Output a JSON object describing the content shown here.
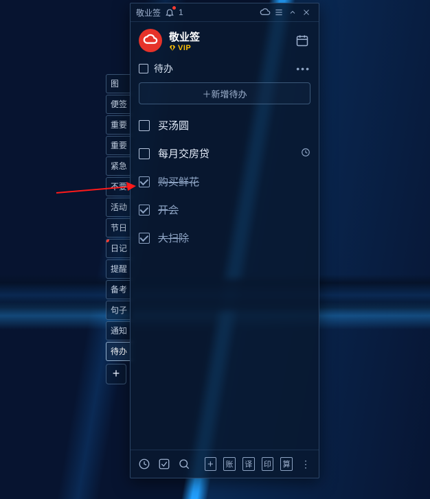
{
  "titlebar": {
    "app_name": "敬业签",
    "notif_count": "1"
  },
  "brand": {
    "name": "敬业签",
    "vip_label": "VIP"
  },
  "section": {
    "title": "待办",
    "more": "•••"
  },
  "add_button": "＋新增待办",
  "sidebar": {
    "items": [
      {
        "label": "图"
      },
      {
        "label": "便签"
      },
      {
        "label": "重要"
      },
      {
        "label": "重要"
      },
      {
        "label": "紧急"
      },
      {
        "label": "不要"
      },
      {
        "label": "活动"
      },
      {
        "label": "节日"
      },
      {
        "label": "日记"
      },
      {
        "label": "提醒"
      },
      {
        "label": "备考"
      },
      {
        "label": "句子"
      },
      {
        "label": "通知"
      },
      {
        "label": "待办"
      }
    ]
  },
  "todos": [
    {
      "label": "买汤圆",
      "checked": false,
      "has_clock": false
    },
    {
      "label": "每月交房贷",
      "checked": false,
      "has_clock": true
    },
    {
      "label": "购买鲜花",
      "checked": true,
      "has_clock": false
    },
    {
      "label": "开会",
      "checked": true,
      "has_clock": false
    },
    {
      "label": "大扫除",
      "checked": true,
      "has_clock": false
    }
  ],
  "footer": {
    "square_buttons": [
      "账",
      "译",
      "印",
      "算"
    ]
  },
  "icons": {
    "bell": "bell-icon",
    "cloud": "cloud-sync-icon",
    "menu": "menu-icon",
    "min": "chevron-up-icon",
    "close": "close-icon",
    "logo": "cloud-logo-icon",
    "vip_diamond": "diamond-icon",
    "calendar": "calendar-icon",
    "clock": "clock-icon",
    "todo": "checkbox-done-icon",
    "search": "search-icon",
    "plus": "plus-icon",
    "more": "more-vert-icon"
  }
}
